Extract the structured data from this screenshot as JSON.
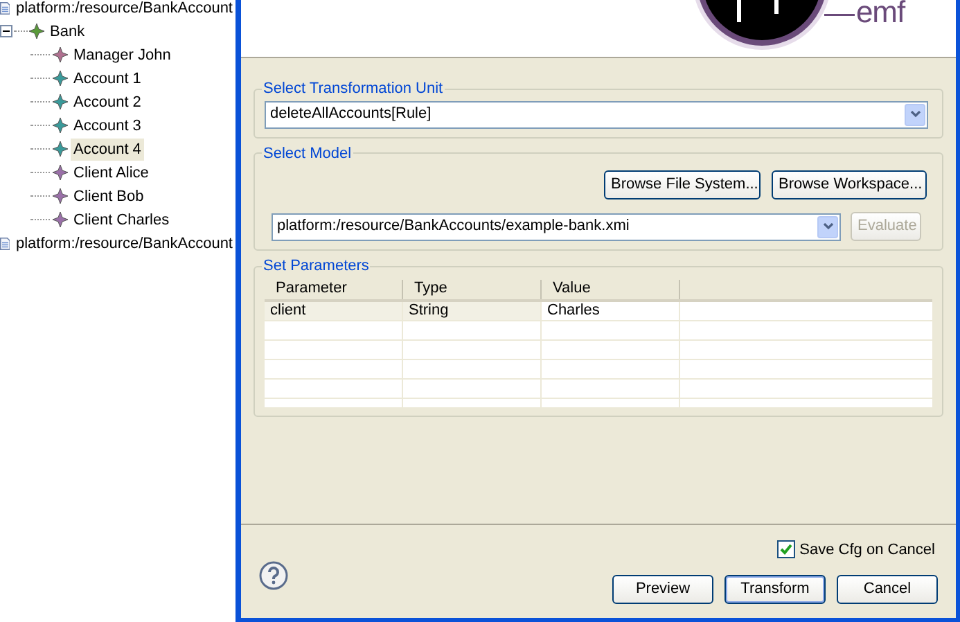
{
  "tree": [
    {
      "label": "platform:/resource/BankAccount",
      "children": [
        {
          "label": "Bank",
          "expanded": true,
          "color": "#5a9a3a",
          "selected": false,
          "children": [
            {
              "label": "Manager John",
              "color": "#b07090",
              "selected": false
            },
            {
              "label": "Account 1",
              "color": "#3a9a9a",
              "selected": false
            },
            {
              "label": "Account 2",
              "color": "#3a9a9a",
              "selected": false
            },
            {
              "label": "Account 3",
              "color": "#3a9a9a",
              "selected": false
            },
            {
              "label": "Account 4",
              "color": "#3a9a9a",
              "selected": true
            },
            {
              "label": "Client Alice",
              "color": "#9a70a8",
              "selected": false
            },
            {
              "label": "Client Bob",
              "color": "#9a70a8",
              "selected": false
            },
            {
              "label": "Client Charles",
              "color": "#9a70a8",
              "selected": false
            }
          ]
        }
      ]
    },
    {
      "label": "platform:/resource/BankAccount"
    }
  ],
  "dialog": {
    "logo_text": "emf",
    "transformation_unit": {
      "legend": "Select Transformation Unit",
      "value": "deleteAllAccounts[Rule]"
    },
    "model": {
      "legend": "Select Model",
      "buttons": [
        {
          "label": "Browse File System...",
          "disabled": false
        },
        {
          "label": "Browse Workspace...",
          "disabled": false
        }
      ],
      "value": "platform:/resource/BankAccounts/example-bank.xmi",
      "evaluate": {
        "label": "Evaluate",
        "disabled": true
      }
    },
    "parameters": {
      "legend": "Set Parameters",
      "columns": [
        "Parameter",
        "Type",
        "Value"
      ],
      "rows": [
        [
          "client",
          "String",
          "Charles"
        ]
      ]
    },
    "save_cfg": {
      "label": "Save Cfg on Cancel",
      "checked": true
    },
    "buttons": [
      {
        "label": "Preview",
        "default": false
      },
      {
        "label": "Transform",
        "default": true
      },
      {
        "label": "Cancel",
        "default": false
      }
    ]
  }
}
